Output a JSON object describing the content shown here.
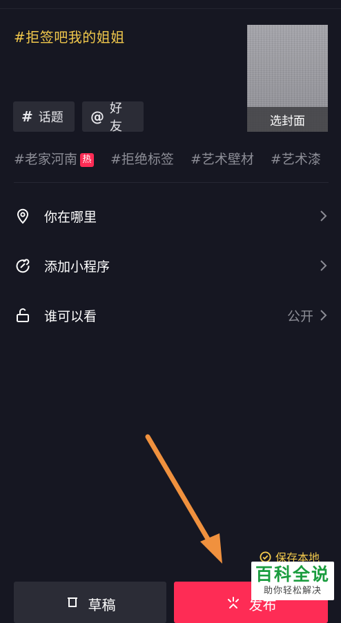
{
  "caption": "#拒签吧我的姐姐",
  "cover": {
    "label": "选封面"
  },
  "chips": {
    "topic": {
      "symbol": "#",
      "label": "话题"
    },
    "friend": {
      "symbol": "@",
      "label": "好友"
    }
  },
  "tags": [
    {
      "text": "#老家河南",
      "badge": "热"
    },
    {
      "text": "#拒绝标签"
    },
    {
      "text": "#艺术壁材"
    },
    {
      "text": "#艺术漆"
    }
  ],
  "options": {
    "location": {
      "label": "你在哪里",
      "icon": "location-pin-icon"
    },
    "mini_program": {
      "label": "添加小程序",
      "icon": "link-icon"
    },
    "privacy": {
      "label": "谁可以看",
      "value": "公开",
      "icon": "unlock-icon"
    }
  },
  "save_local": {
    "label": "保存本地",
    "checked": true
  },
  "buttons": {
    "draft": {
      "label": "草稿",
      "icon": "draft-box-icon"
    },
    "publish": {
      "label": "发布",
      "icon": "sparkle-upload-icon"
    }
  },
  "watermark": {
    "main": "百科全说",
    "sub": "助你轻松解决"
  },
  "colors": {
    "background": "#161722",
    "accent_yellow": "#f2c94c",
    "publish_red": "#fe2c55",
    "annotation_arrow": "#f0913e",
    "watermark_green": "#1a9c3e"
  }
}
